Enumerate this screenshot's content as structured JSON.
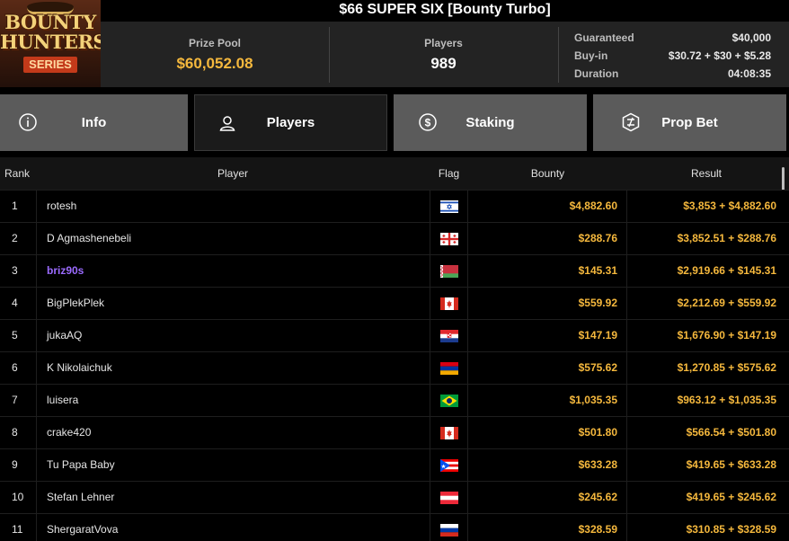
{
  "logo": {
    "line1": "BOUNTY",
    "line2": "HUNTERS",
    "line3": "SERIES"
  },
  "title": "$66 SUPER SIX [Bounty Turbo]",
  "summary": {
    "prize_pool_label": "Prize Pool",
    "prize_pool_value": "$60,052.08",
    "players_label": "Players",
    "players_value": "989",
    "details": [
      {
        "label": "Guaranteed",
        "value": "$40,000"
      },
      {
        "label": "Buy-in",
        "value": "$30.72 + $30 + $5.28"
      },
      {
        "label": "Duration",
        "value": "04:08:35"
      }
    ]
  },
  "tabs": [
    {
      "label": "Info",
      "icon": "info-icon",
      "active": false
    },
    {
      "label": "Players",
      "icon": "user-icon",
      "active": true
    },
    {
      "label": "Staking",
      "icon": "dollar-coin-icon",
      "active": false
    },
    {
      "label": "Prop Bet",
      "icon": "prop-bet-icon",
      "active": false
    }
  ],
  "table": {
    "headers": {
      "rank": "Rank",
      "player": "Player",
      "flag": "Flag",
      "bounty": "Bounty",
      "result": "Result"
    },
    "rows": [
      {
        "rank": "1",
        "player": "rotesh",
        "flag": "israel",
        "bounty": "$4,882.60",
        "result": "$3,853 + $4,882.60",
        "highlight": false
      },
      {
        "rank": "2",
        "player": "D Agmashenebeli",
        "flag": "georgia",
        "bounty": "$288.76",
        "result": "$3,852.51 + $288.76",
        "highlight": false
      },
      {
        "rank": "3",
        "player": "briz90s",
        "flag": "belarus",
        "bounty": "$145.31",
        "result": "$2,919.66 + $145.31",
        "highlight": true
      },
      {
        "rank": "4",
        "player": "BigPlekPlek",
        "flag": "canada",
        "bounty": "$559.92",
        "result": "$2,212.69 + $559.92",
        "highlight": false
      },
      {
        "rank": "5",
        "player": "jukaAQ",
        "flag": "croatia",
        "bounty": "$147.19",
        "result": "$1,676.90 + $147.19",
        "highlight": false
      },
      {
        "rank": "6",
        "player": "K Nikolaichuk",
        "flag": "armenia",
        "bounty": "$575.62",
        "result": "$1,270.85 + $575.62",
        "highlight": false
      },
      {
        "rank": "7",
        "player": "luisera",
        "flag": "brazil",
        "bounty": "$1,035.35",
        "result": "$963.12 + $1,035.35",
        "highlight": false
      },
      {
        "rank": "8",
        "player": "crake420",
        "flag": "canada",
        "bounty": "$501.80",
        "result": "$566.54 + $501.80",
        "highlight": false
      },
      {
        "rank": "9",
        "player": "Tu Papa Baby",
        "flag": "puerto-rico",
        "bounty": "$633.28",
        "result": "$419.65 + $633.28",
        "highlight": false
      },
      {
        "rank": "10",
        "player": "Stefan Lehner",
        "flag": "austria",
        "bounty": "$245.62",
        "result": "$419.65 + $245.62",
        "highlight": false
      },
      {
        "rank": "11",
        "player": "ShergaratVova",
        "flag": "russia",
        "bounty": "$328.59",
        "result": "$310.85 + $328.59",
        "highlight": false
      }
    ]
  },
  "colors": {
    "accent_gold": "#f5b83d",
    "highlight_purple": "#9b6bff",
    "tab_bg": "#5b5b5b",
    "tab_active_bg": "#1b1b1b"
  }
}
